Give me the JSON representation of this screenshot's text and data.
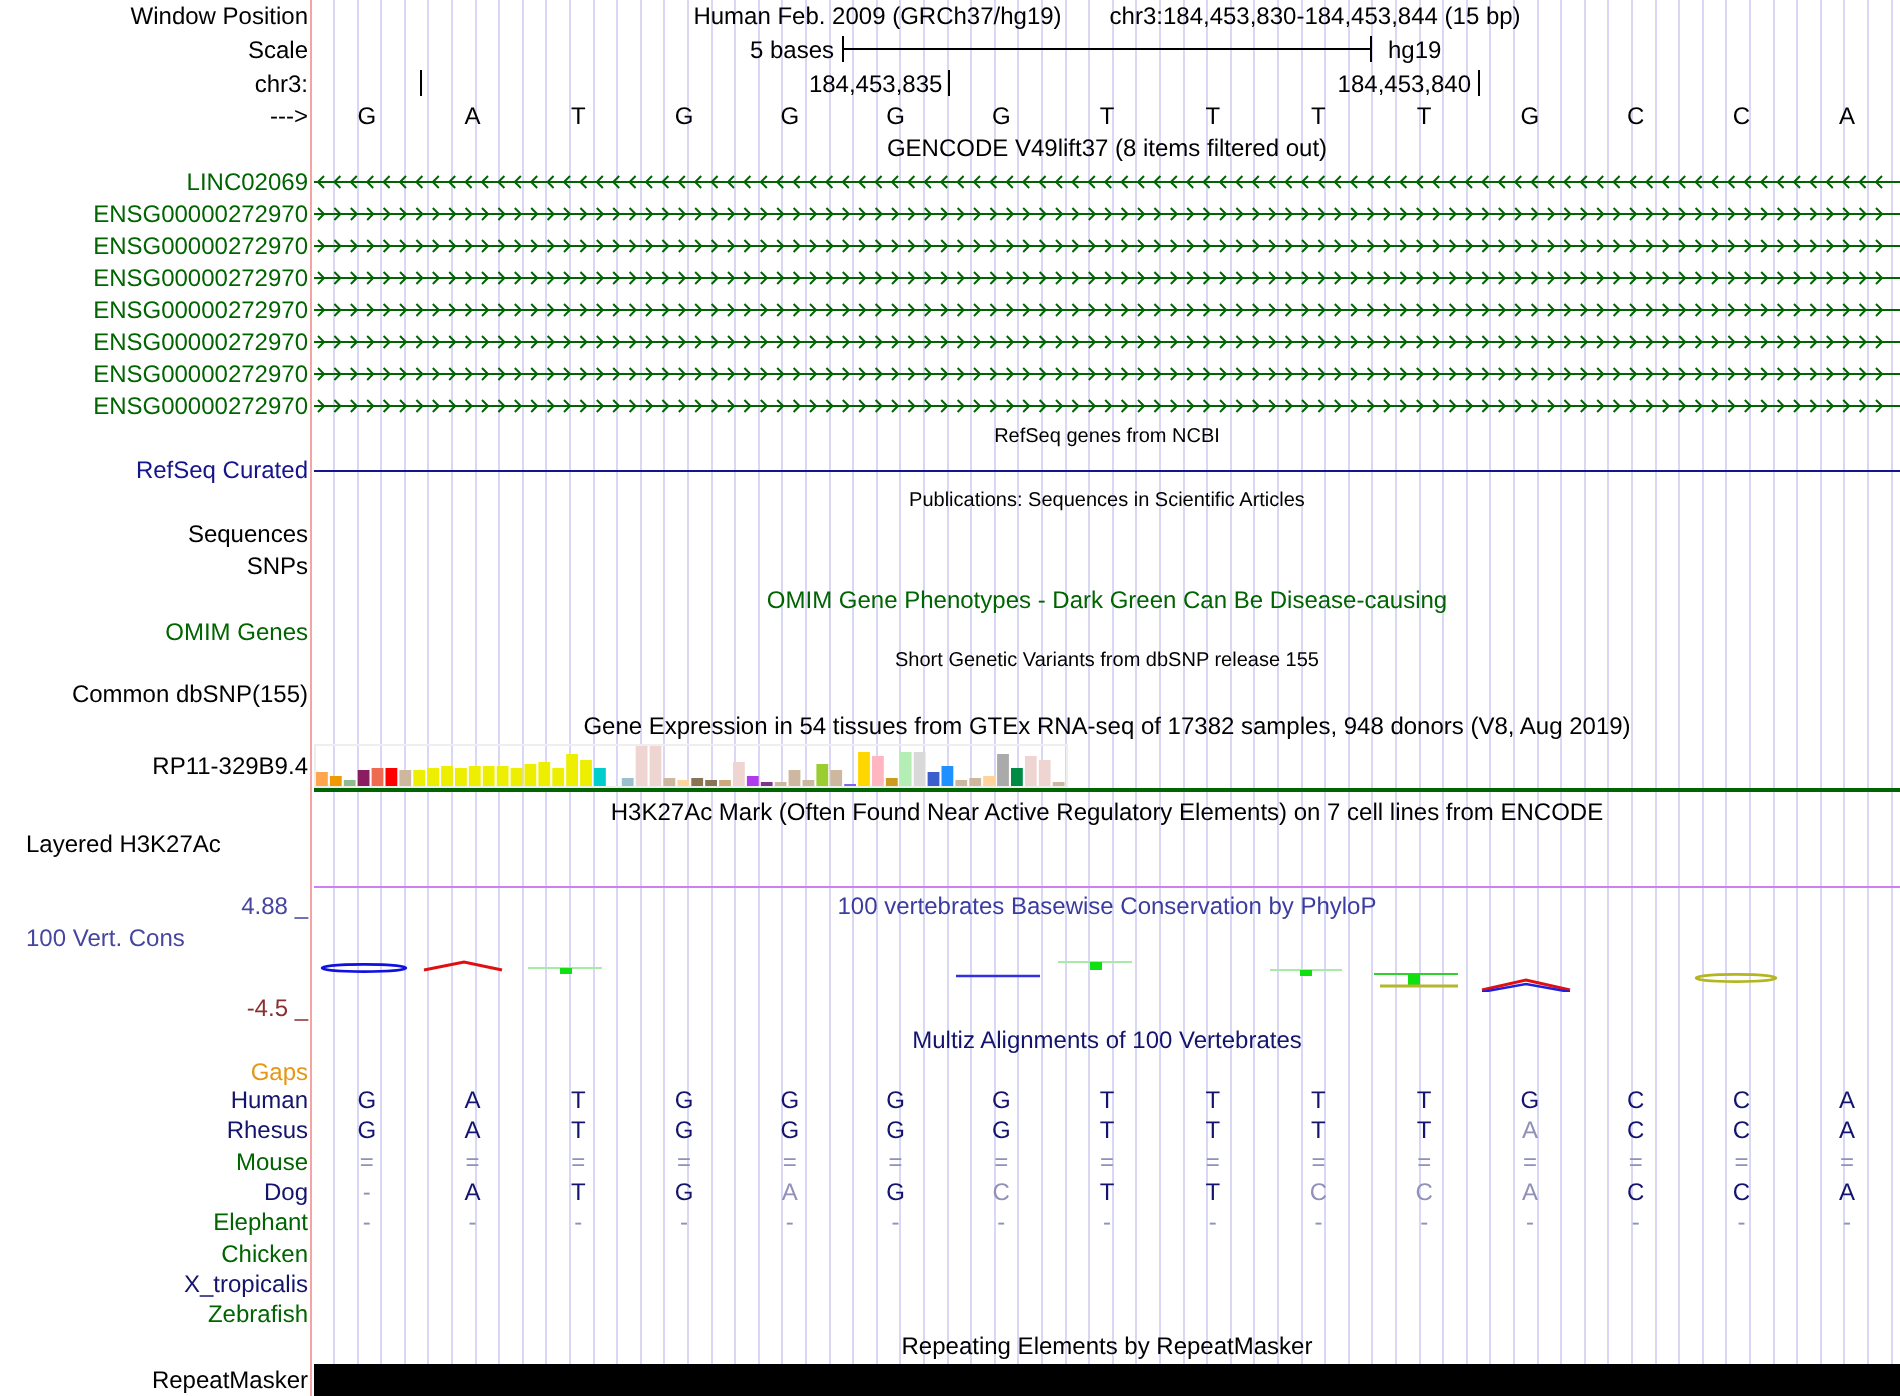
{
  "header": {
    "labels": [
      "Window Position",
      "Scale",
      "chr3:",
      "--->"
    ],
    "assembly": "Human Feb. 2009 (GRCh37/hg19)",
    "position": "chr3:184,453,830-184,453,844 (15 bp)",
    "scale": {
      "length": "5 bases",
      "db": "hg19"
    },
    "ruler_labels": [
      "184,453,835",
      "184,453,840"
    ],
    "bases": [
      "G",
      "A",
      "T",
      "G",
      "G",
      "G",
      "G",
      "T",
      "T",
      "T",
      "T",
      "G",
      "C",
      "C",
      "A"
    ]
  },
  "tracks": [
    {
      "kind": "gencode",
      "title": {
        "text": "GENCODE V49lift37 (8 items filtered out)",
        "color": "#000000"
      },
      "items": [
        {
          "name": "LINC02069",
          "reverse": true,
          "color": "#006400"
        },
        {
          "name": "ENSG00000272970",
          "reverse": false,
          "color": "#006400"
        },
        {
          "name": "ENSG00000272970",
          "reverse": false,
          "color": "#006400"
        },
        {
          "name": "ENSG00000272970",
          "reverse": false,
          "color": "#006400"
        },
        {
          "name": "ENSG00000272970",
          "reverse": false,
          "color": "#006400"
        },
        {
          "name": "ENSG00000272970",
          "reverse": false,
          "color": "#006400"
        },
        {
          "name": "ENSG00000272970",
          "reverse": false,
          "color": "#006400"
        },
        {
          "name": "ENSG00000272970",
          "reverse": false,
          "color": "#006400"
        }
      ]
    },
    {
      "kind": "refseq",
      "title": {
        "text": "RefSeq genes from NCBI",
        "color": "#000000"
      },
      "label": {
        "text": "RefSeq Curated",
        "color": "#14148c"
      }
    },
    {
      "kind": "publications",
      "title": {
        "text": "Publications: Sequences in Scientific Articles",
        "color": "#000000"
      },
      "labels": [
        {
          "text": "Sequences",
          "color": "#000000"
        },
        {
          "text": "SNPs",
          "color": "#000000"
        }
      ]
    },
    {
      "kind": "omim",
      "title": {
        "text": "OMIM Gene Phenotypes - Dark Green Can Be Disease-causing",
        "color": "#006400"
      },
      "label": {
        "text": "OMIM Genes",
        "color": "#006400"
      }
    },
    {
      "kind": "dbsnp",
      "title": {
        "text": "Short Genetic Variants from dbSNP release 155",
        "color": "#000000"
      },
      "label": {
        "text": "Common dbSNP(155)",
        "color": "#000000"
      }
    },
    {
      "kind": "gtex",
      "title": {
        "text": "Gene Expression in 54 tissues from GTEx RNA-seq of 17382 samples, 948 donors (V8, Aug 2019)",
        "color": "#000000"
      },
      "label": {
        "text": "RP11-329B9.4",
        "color": "#000000"
      }
    },
    {
      "kind": "h3k27ac",
      "title": {
        "text": "H3K27Ac Mark (Often Found Near Active Regulatory Elements) on 7 cell lines from ENCODE",
        "color": "#000000"
      },
      "label": {
        "text": "Layered H3K27Ac",
        "color": "#000000"
      }
    },
    {
      "kind": "phylop",
      "title": {
        "text": "100 vertebrates Basewise Conservation by PhyloP",
        "color": "#3c3ca0"
      },
      "label": {
        "text": "100 Vert. Cons",
        "color": "#4646a0"
      },
      "axis_max": {
        "text": "4.88 _",
        "color": "#4646a0"
      },
      "axis_min": {
        "text": "-4.5 _",
        "color": "#8b3030"
      }
    },
    {
      "kind": "multiz",
      "title": {
        "text": "Multiz Alignments of 100 Vertebrates",
        "color": "#14146e"
      },
      "gaps_label": {
        "text": "Gaps",
        "color": "#e69614"
      },
      "species": [
        {
          "name": "Human",
          "color": "#14146e",
          "bases": [
            "G",
            "A",
            "T",
            "G",
            "G",
            "G",
            "G",
            "T",
            "T",
            "T",
            "T",
            "G",
            "C",
            "C",
            "A"
          ],
          "matches": [
            true,
            true,
            true,
            true,
            true,
            true,
            true,
            true,
            true,
            true,
            true,
            true,
            true,
            true,
            true
          ]
        },
        {
          "name": "Rhesus",
          "color": "#14146e",
          "bases": [
            "G",
            "A",
            "T",
            "G",
            "G",
            "G",
            "G",
            "T",
            "T",
            "T",
            "T",
            "A",
            "C",
            "C",
            "A"
          ],
          "matches": [
            true,
            true,
            true,
            true,
            true,
            true,
            true,
            true,
            true,
            true,
            true,
            false,
            true,
            true,
            true
          ]
        },
        {
          "name": "Mouse",
          "color": "#006400",
          "bases": [
            "=",
            "=",
            "=",
            "=",
            "=",
            "=",
            "=",
            "=",
            "=",
            "=",
            "=",
            "=",
            "=",
            "=",
            "="
          ],
          "matches": [
            false,
            false,
            false,
            false,
            false,
            false,
            false,
            false,
            false,
            false,
            false,
            false,
            false,
            false,
            false
          ]
        },
        {
          "name": "Dog",
          "color": "#14146e",
          "bases": [
            "-",
            "A",
            "T",
            "G",
            "A",
            "G",
            "C",
            "T",
            "T",
            "C",
            "C",
            "A",
            "C",
            "C",
            "A"
          ],
          "matches": [
            false,
            true,
            true,
            true,
            false,
            true,
            false,
            true,
            true,
            false,
            false,
            false,
            true,
            true,
            true
          ]
        },
        {
          "name": "Elephant",
          "color": "#006400",
          "bases": [
            "-",
            "-",
            "-",
            "-",
            "-",
            "-",
            "-",
            "-",
            "-",
            "-",
            "-",
            "-",
            "-",
            "-",
            "-"
          ],
          "matches": [
            false,
            false,
            false,
            false,
            false,
            false,
            false,
            false,
            false,
            false,
            false,
            false,
            false,
            false,
            false
          ]
        },
        {
          "name": "Chicken",
          "color": "#006400"
        },
        {
          "name": "X_tropicalis",
          "color": "#14146e"
        },
        {
          "name": "Zebrafish",
          "color": "#006400"
        }
      ]
    },
    {
      "kind": "repeatmasker",
      "title": {
        "text": "Repeating Elements by RepeatMasker",
        "color": "#000000"
      },
      "label": {
        "text": "RepeatMasker",
        "color": "#000000"
      }
    }
  ]
}
